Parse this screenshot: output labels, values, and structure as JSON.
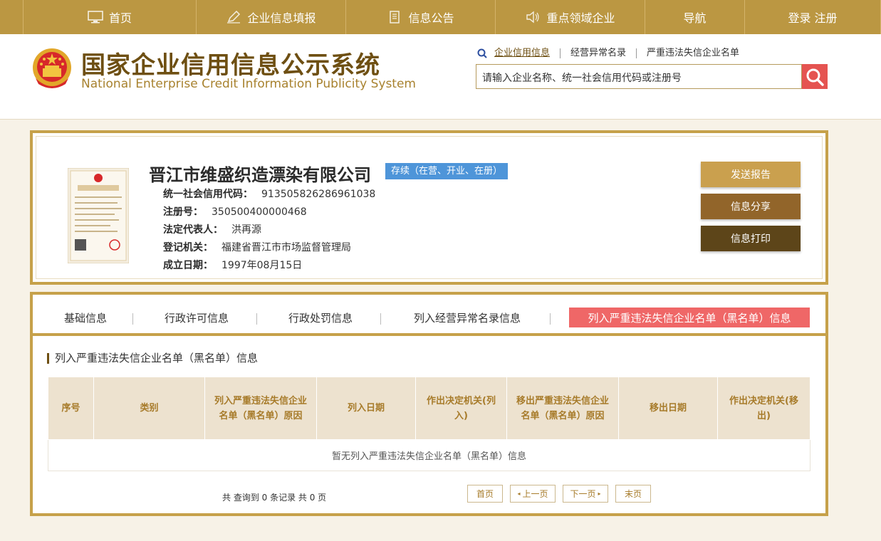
{
  "nav": {
    "items": [
      {
        "label": "首页",
        "icon": "monitor-icon"
      },
      {
        "label": "企业信息填报",
        "icon": "pen-icon"
      },
      {
        "label": "信息公告",
        "icon": "document-icon"
      },
      {
        "label": "重点领域企业",
        "icon": "speaker-icon"
      },
      {
        "label": "导航",
        "icon": ""
      },
      {
        "label": "登录  注册",
        "icon": ""
      }
    ]
  },
  "header": {
    "title_cn": "国家企业信用信息公示系统",
    "title_en": "National Enterprise Credit Information Publicity System",
    "search_links": [
      "企业信用信息",
      "经营异常名录",
      "严重违法失信企业名单"
    ],
    "search_placeholder": "请输入企业名称、统一社会信用代码或注册号"
  },
  "company": {
    "name": "晋江市维盛织造漂染有限公司",
    "status": "存续（在营、开业、在册）",
    "fields": [
      {
        "label": "统一社会信用代码：",
        "value": "913505826286961038"
      },
      {
        "label": "注册号：",
        "value": "350500400000468"
      },
      {
        "label": "法定代表人：",
        "value": "洪再源"
      },
      {
        "label": "登记机关：",
        "value": "福建省晋江市市场监督管理局"
      },
      {
        "label": "成立日期：",
        "value": "1997年08月15日"
      }
    ],
    "buttons": {
      "send": "发送报告",
      "share": "信息分享",
      "print": "信息打印"
    }
  },
  "tabs": [
    {
      "label": "基础信息"
    },
    {
      "label": "行政许可信息"
    },
    {
      "label": "行政处罚信息"
    },
    {
      "label": "列入经营异常名录信息"
    },
    {
      "label": "列入严重违法失信企业名单（黑名单）信息"
    }
  ],
  "section": {
    "title": "列入严重违法失信企业名单（黑名单）信息",
    "columns": [
      "序号",
      "类别",
      "列入严重违法失信企业名单（黑名单）原因",
      "列入日期",
      "作出决定机关(列入)",
      "移出严重违法失信企业名单（黑名单）原因",
      "移出日期",
      "作出决定机关(移出)"
    ],
    "empty_text": "暂无列入严重违法失信企业名单（黑名单）信息",
    "pager": {
      "summary": "共 查询到 0 条记录 共 0 页",
      "first": "首页",
      "prev": "上一页",
      "next": "下一页",
      "last": "末页"
    }
  },
  "colors": {
    "nav_bg": "#bb9742",
    "title_brown": "#6e4f12",
    "border_gold": "#c6a14a",
    "active_tab": "#ef6767",
    "status_badge": "#4e95d9",
    "search_btn": "#e55451"
  }
}
